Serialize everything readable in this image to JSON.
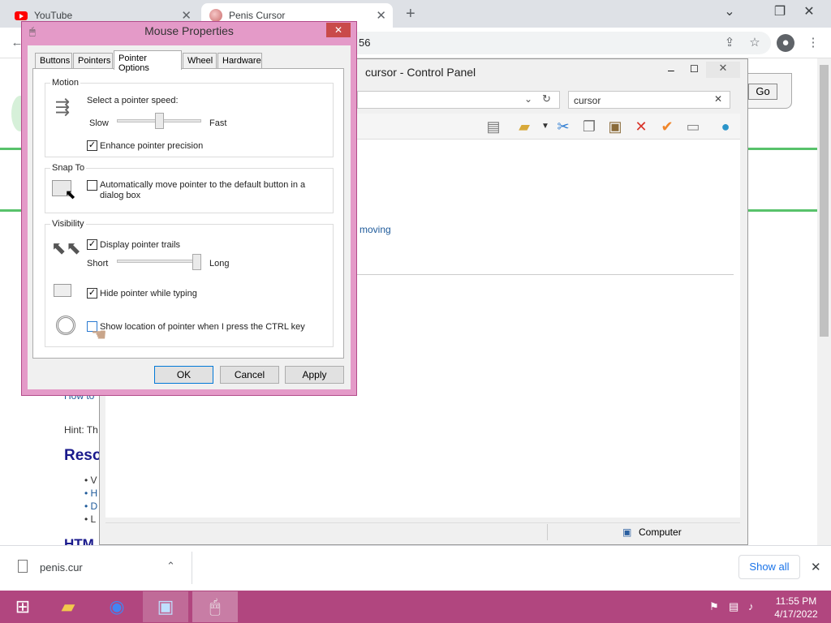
{
  "browser": {
    "tabs": [
      {
        "title": "YouTube"
      },
      {
        "title": "Penis Cursor"
      }
    ],
    "address_fragment": "56"
  },
  "page": {
    "how_to_fragment": "How to",
    "hint_fragment": "Hint: Th",
    "resources_fragment": "Reso",
    "bullets": [
      "V",
      "H",
      "D",
      "L"
    ],
    "html_fragment": "HTM",
    "go_label": "Go"
  },
  "control_panel": {
    "title": "cursor - Control Panel",
    "search_value": "cursor",
    "moving_link": "moving",
    "status_label": "Computer"
  },
  "dialog": {
    "title": "Mouse Properties",
    "tabs": [
      "Buttons",
      "Pointers",
      "Pointer Options",
      "Wheel",
      "Hardware"
    ],
    "active_tab": "Pointer Options",
    "motion": {
      "group_title": "Motion",
      "speed_label": "Select a pointer speed:",
      "slow_label": "Slow",
      "fast_label": "Fast",
      "speed_level": 0.5,
      "enhance_label": "Enhance pointer precision",
      "enhance_checked": true
    },
    "snap_to": {
      "group_title": "Snap To",
      "label_line1": "Automatically move pointer to the default button in a",
      "label_line2": "dialog box",
      "checked": false
    },
    "visibility": {
      "group_title": "Visibility",
      "trails_label": "Display pointer trails",
      "trails_checked": true,
      "short_label": "Short",
      "long_label": "Long",
      "trail_level": 1.0,
      "hide_label": "Hide pointer while typing",
      "hide_checked": true,
      "ctrl_label": "Show location of pointer when I press the CTRL key",
      "ctrl_checked": false
    },
    "buttons": {
      "ok": "OK",
      "cancel": "Cancel",
      "apply": "Apply"
    }
  },
  "download_bar": {
    "filename": "penis.cur",
    "show_all": "Show all"
  },
  "taskbar": {
    "time": "11:55 PM",
    "date": "4/17/2022"
  }
}
